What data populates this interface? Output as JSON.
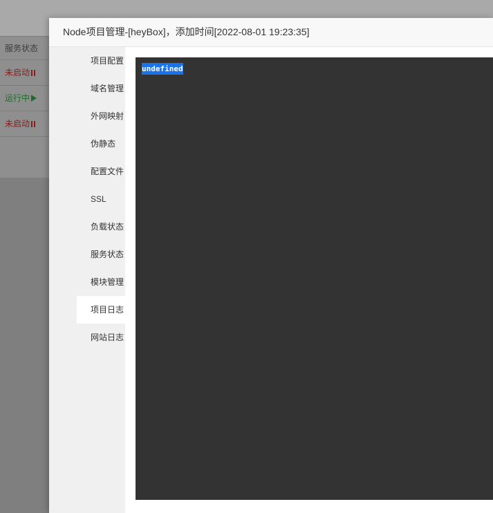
{
  "background": {
    "rows": [
      {
        "label": "服务状态",
        "kind": "header"
      },
      {
        "label": "未启动",
        "kind": "stopped"
      },
      {
        "label": "运行中",
        "kind": "running"
      },
      {
        "label": "未启动",
        "kind": "stopped"
      }
    ]
  },
  "modal": {
    "title": "Node项目管理-[heyBox]，添加时间[2022-08-01 19:23:35]",
    "nav": [
      {
        "label": "项目配置"
      },
      {
        "label": "域名管理"
      },
      {
        "label": "外网映射"
      },
      {
        "label": "伪静态"
      },
      {
        "label": "配置文件"
      },
      {
        "label": "SSL"
      },
      {
        "label": "负载状态"
      },
      {
        "label": "服务状态"
      },
      {
        "label": "模块管理"
      },
      {
        "label": "项目日志",
        "active": true
      },
      {
        "label": "网站日志"
      }
    ],
    "log": {
      "text": "undefined"
    }
  },
  "colors": {
    "stopped": "#8b1c1c",
    "running": "#1e6b2a",
    "log_bg": "#333333",
    "selection": "#1a73e8",
    "nav_bg": "#f0f0f0"
  }
}
